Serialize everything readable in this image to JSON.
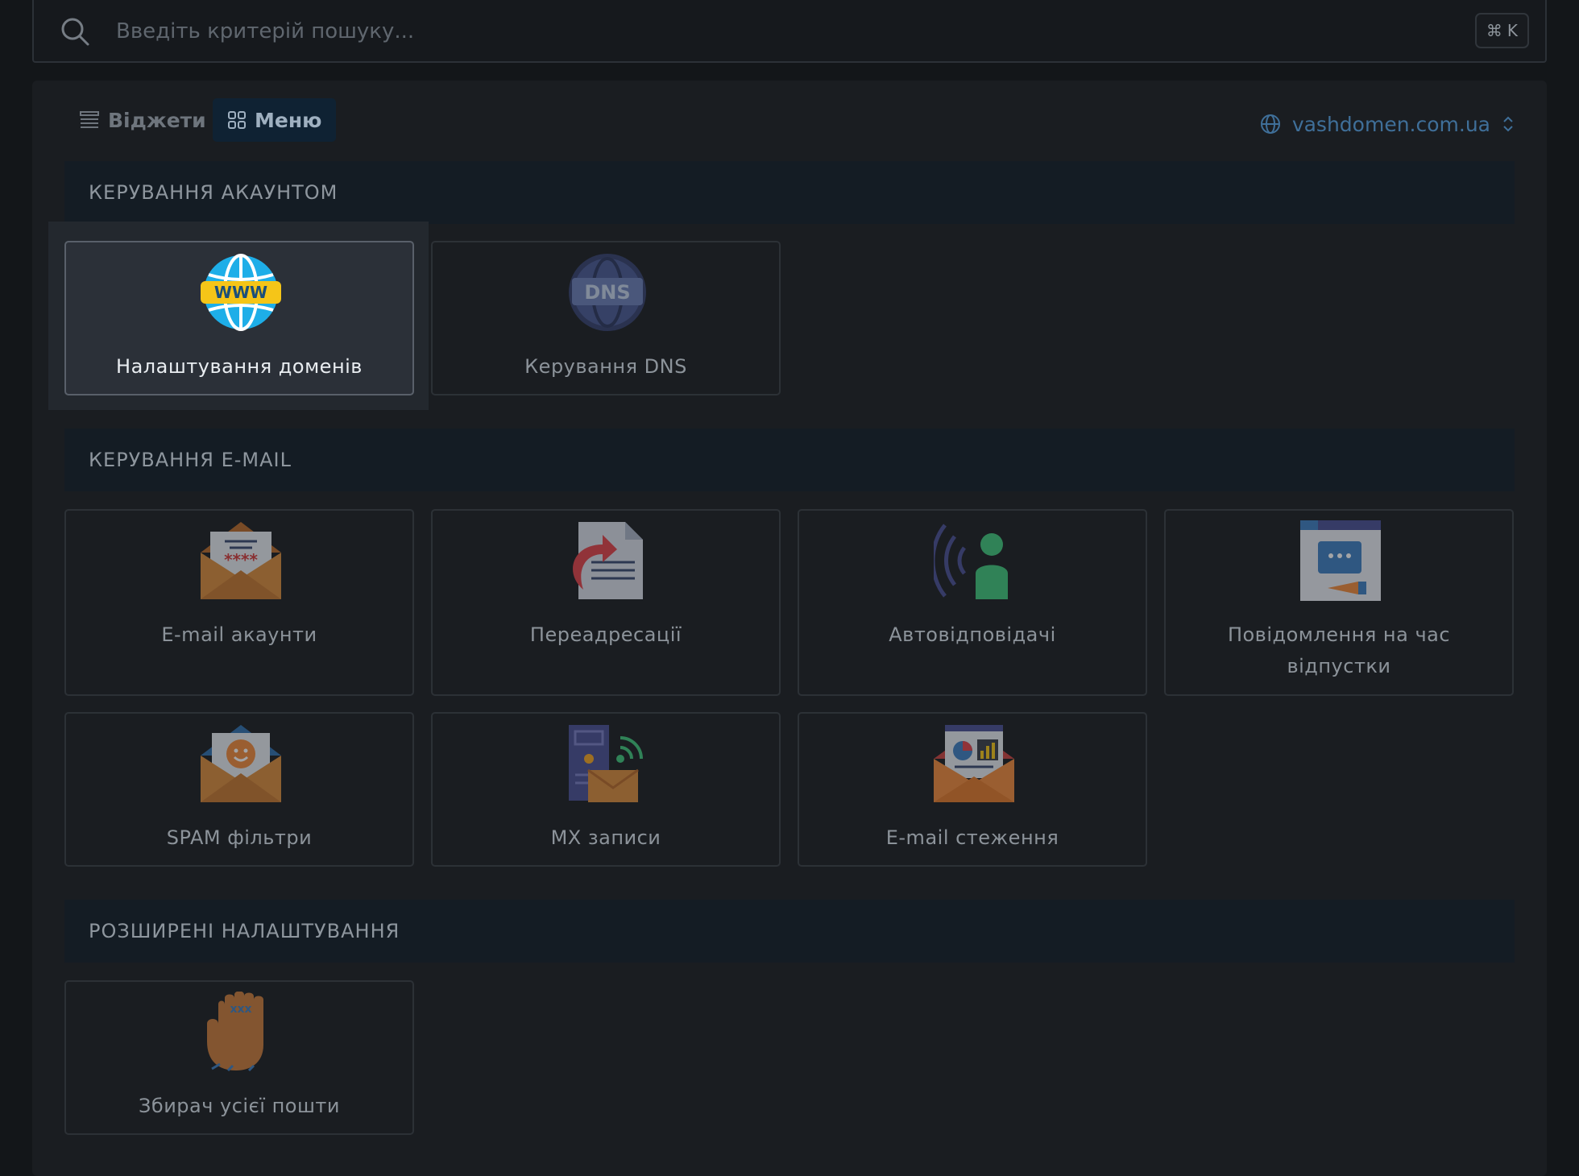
{
  "search": {
    "placeholder": "Введіть критерій пошуку...",
    "shortcut_symbol": "⌘",
    "shortcut_key": "K"
  },
  "view_toggle": {
    "widgets_label": "Віджети",
    "menu_label": "Меню",
    "active": "menu"
  },
  "domain_selector": {
    "value": "vashdomen.com.ua"
  },
  "sections": [
    {
      "title": "КЕРУВАННЯ АКАУНТОМ",
      "items": [
        {
          "label": "Налаштування доменів",
          "icon": "www-globe-icon"
        },
        {
          "label": "Керування DNS",
          "icon": "dns-globe-icon"
        }
      ]
    },
    {
      "title": "КЕРУВАННЯ E-MAIL",
      "items": [
        {
          "label": "E-mail акаунти",
          "icon": "envelope-password-icon"
        },
        {
          "label": "Переадресації",
          "icon": "forward-document-icon"
        },
        {
          "label": "Автовідповідачі",
          "icon": "autoresponder-person-icon"
        },
        {
          "label": "Повідомлення на час відпустки",
          "icon": "vacation-message-icon"
        },
        {
          "label": "SPAM фільтри",
          "icon": "smiley-envelope-icon"
        },
        {
          "label": "MX записи",
          "icon": "server-mail-icon"
        },
        {
          "label": "E-mail стеження",
          "icon": "email-stats-icon"
        }
      ]
    },
    {
      "title": "РОЗШИРЕНІ НАЛАШТУВАННЯ",
      "items": [
        {
          "label": "Збирач усієї пошти",
          "icon": "catch-all-hand-icon"
        }
      ]
    }
  ],
  "colors": {
    "background": "#131619",
    "panel": "#1a1d21",
    "section_header": "#141c24",
    "accent_link": "#3f6f99",
    "active_tile": "#2b3038"
  }
}
